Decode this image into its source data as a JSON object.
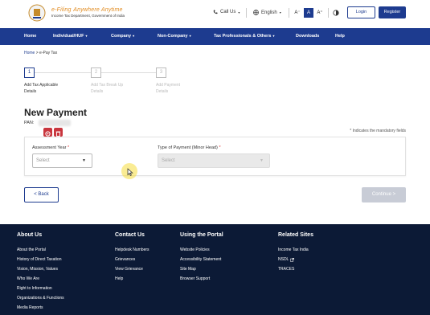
{
  "header": {
    "brand_title": "e-Filing",
    "brand_tagline": "Anywhere Anytime",
    "brand_subtitle": "Income Tax Department, Government of India",
    "call_us": "Call Us",
    "language": "English",
    "font_small": "A⁻",
    "font_normal": "A",
    "font_large": "A⁺",
    "login_label": "Login",
    "register_label": "Register"
  },
  "nav": {
    "items": [
      "Home",
      "Individual/HUF",
      "Company",
      "Non-Company",
      "Tax Professionals & Others",
      "Downloads",
      "Help"
    ]
  },
  "breadcrumb": {
    "home": "Home",
    "separator": ">",
    "current": "e-Pay Tax"
  },
  "stepper": {
    "steps": [
      {
        "number": "1",
        "label_line1": "Add Tax Applicable",
        "label_line2": "Details"
      },
      {
        "number": "2",
        "label_line1": "Add Tax Break Up",
        "label_line2": "Details"
      },
      {
        "number": "3",
        "label_line1": "Add Payment",
        "label_line2": "Details"
      }
    ]
  },
  "page": {
    "title": "New Payment",
    "pan_label": "PAN:",
    "mandatory_note": "* Indicates the mandatory fields"
  },
  "form": {
    "assessment_year_label": "Assessment Year",
    "assessment_year_placeholder": "Select",
    "payment_type_label": "Type of Payment (Minor Head)",
    "payment_type_placeholder": "Select",
    "required_mark": "*"
  },
  "actions": {
    "back_label": "< Back",
    "continue_label": "Continue >"
  },
  "footer": {
    "about": {
      "heading": "About Us",
      "links": [
        "About the Portal",
        "History of Direct Taxation",
        "Vision, Mission, Values",
        "Who We Are",
        "Right to Information",
        "Organizations & Functions",
        "Media Reports"
      ]
    },
    "contact": {
      "heading": "Contact Us",
      "links": [
        "Helpdesk Numbers",
        "Grievances",
        "View Grievance",
        "Help"
      ]
    },
    "portal": {
      "heading": "Using the Portal",
      "links": [
        "Website Policies",
        "Accessibility Statement",
        "Site Map",
        "Browser Support"
      ]
    },
    "related": {
      "heading": "Related Sites",
      "links": [
        "Income Tax India",
        "NSDL",
        "TRACES"
      ]
    }
  },
  "colors": {
    "brand_blue": "#1d3b8f",
    "footer_bg": "#0c1a36",
    "accent_red": "#c9363e"
  }
}
